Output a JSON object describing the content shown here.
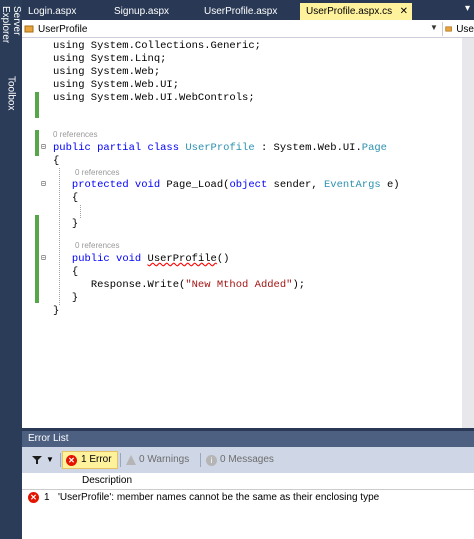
{
  "side_tabs": [
    "Server Explorer",
    "Toolbox"
  ],
  "tabs": [
    {
      "label": "Login.aspx"
    },
    {
      "label": "Signup.aspx"
    },
    {
      "label": "UserProfile.aspx"
    },
    {
      "label": "UserProfile.aspx.cs",
      "active": true,
      "close": "✕"
    }
  ],
  "tab_dropdown": "▾",
  "nav": {
    "left": "UserProfile",
    "right": "Use"
  },
  "code": {
    "using1": "using System.Collections.Generic;",
    "using2": "using System.Linq;",
    "using3": "using System.Web;",
    "using4": "using System.Web.UI;",
    "using5": "using System.Web.UI.WebControls;",
    "ref1": "0 references",
    "ref2": "0 references",
    "ref3": "0 references",
    "cls_kw": "public partial class",
    "cls_name": "UserProfile",
    "cls_sep": " : System.Web.UI.",
    "cls_base": "Page",
    "open_brace": "{",
    "close_brace": "}",
    "pl_kw1": "protected void",
    "pl_name": " Page_Load(",
    "pl_kw2": "object",
    "pl_mid": " sender, ",
    "pl_type": "EventArgs",
    "pl_end": " e)",
    "up_kw": "public void",
    "up_name": "UserProfile",
    "up_parens": "()",
    "resp_start": "Response.Write(",
    "resp_str": "\"New Mthod Added\"",
    "resp_end": ");"
  },
  "error_list": {
    "title": "Error List",
    "errors_label": "1 Error",
    "warnings_label": "0 Warnings",
    "messages_label": "0 Messages",
    "col_description": "Description",
    "rows": [
      {
        "num": "1",
        "description": "'UserProfile': member names cannot be the same as their enclosing type"
      }
    ]
  },
  "colors": {
    "keyword": "#0000ff",
    "type": "#2b91af",
    "string": "#a31515",
    "active_tab": "#fff29d",
    "change_bar": "#57a64a"
  }
}
